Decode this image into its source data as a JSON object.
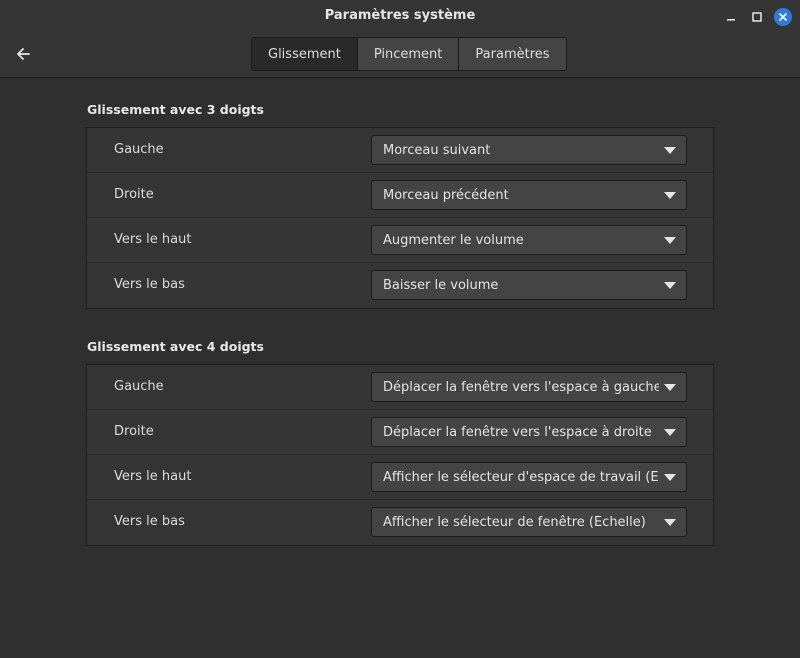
{
  "window": {
    "title": "Paramètres système"
  },
  "header": {
    "back_icon": "back-arrow-icon",
    "tabs": [
      {
        "label": "Glissement",
        "active": true
      },
      {
        "label": "Pincement",
        "active": false
      },
      {
        "label": "Paramètres",
        "active": false
      }
    ],
    "wm": {
      "minimize_icon": "minimize-icon",
      "maximize_icon": "maximize-icon",
      "close_icon": "close-icon",
      "close_color": "#2f7bd6"
    }
  },
  "sections": [
    {
      "title": "Glissement avec 3 doigts",
      "rows": [
        {
          "label": "Gauche",
          "value": "Morceau suivant"
        },
        {
          "label": "Droite",
          "value": "Morceau précédent"
        },
        {
          "label": "Vers le haut",
          "value": "Augmenter le volume"
        },
        {
          "label": "Vers le bas",
          "value": "Baisser le volume"
        }
      ]
    },
    {
      "title": "Glissement avec 4 doigts",
      "rows": [
        {
          "label": "Gauche",
          "value": "Déplacer la fenêtre vers l'espace à gauche"
        },
        {
          "label": "Droite",
          "value": "Déplacer la fenêtre vers l'espace à droite"
        },
        {
          "label": "Vers le haut",
          "value": "Afficher le sélecteur d'espace de travail (Expo)"
        },
        {
          "label": "Vers le bas",
          "value": "Afficher le sélecteur de fenêtre (Échelle)"
        }
      ]
    }
  ]
}
